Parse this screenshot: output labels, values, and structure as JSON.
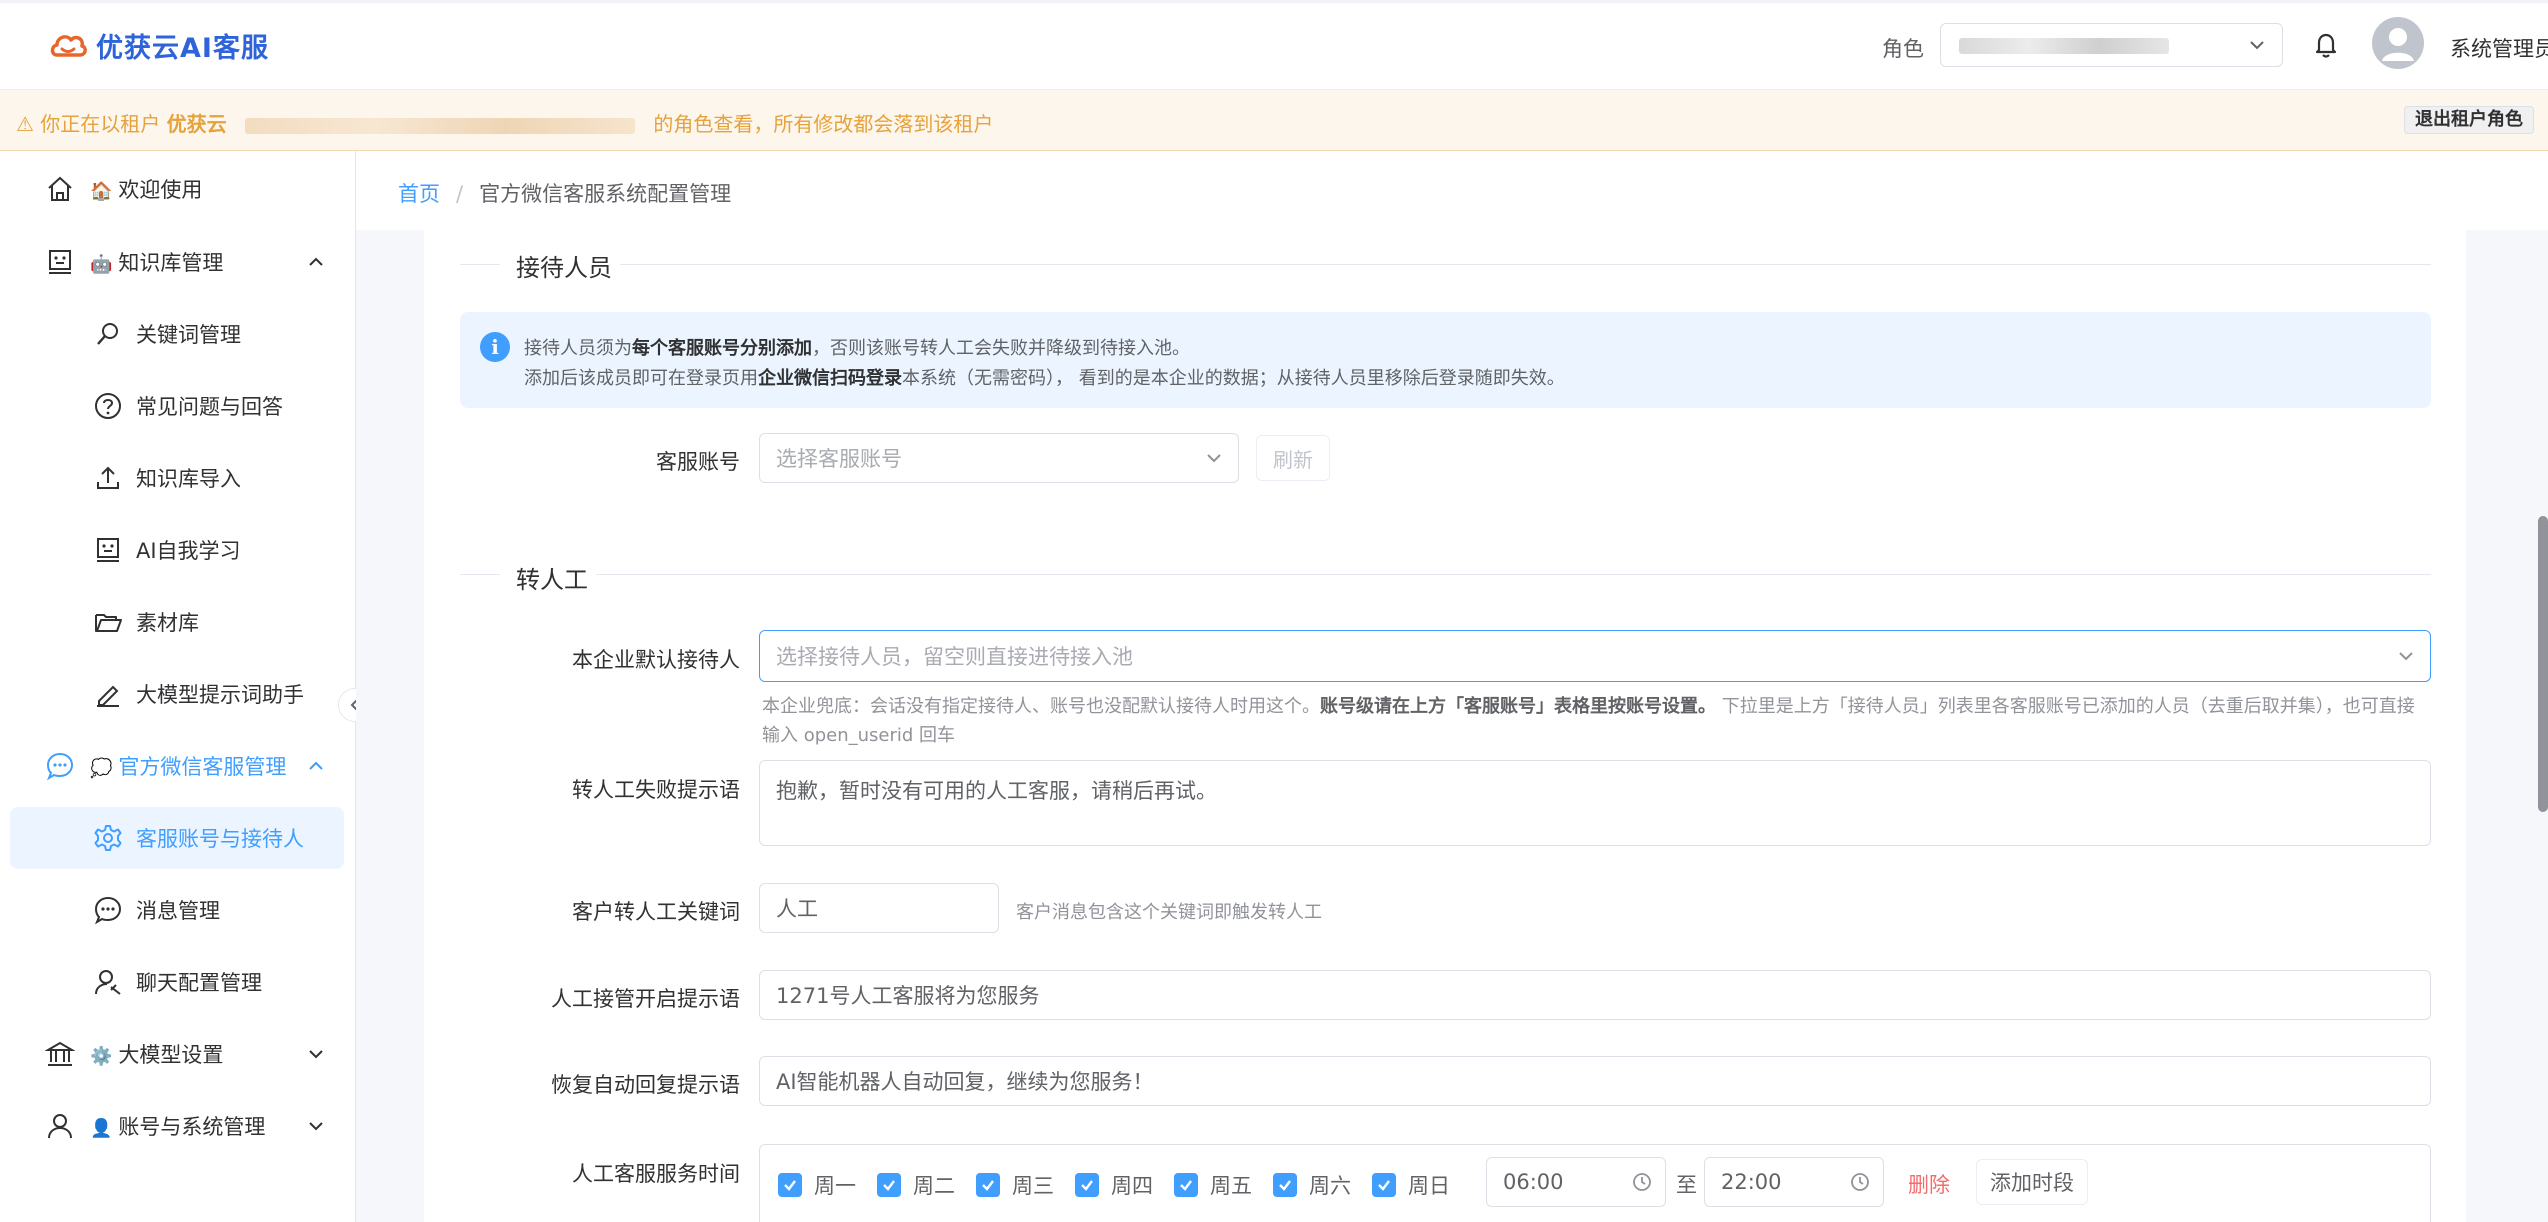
{
  "app": {
    "brand": "优获云AI客服",
    "role_label": "角色",
    "user_name": "系统管理员"
  },
  "warning": {
    "prefix": "⚠ 你正在以租户",
    "tenant": "优获云",
    "suffix": "的角色查看，所有修改都会落到该租户",
    "exit_button": "退出租户角色"
  },
  "sidebar": {
    "items": [
      {
        "label": "欢迎使用",
        "emoji": "🏠"
      },
      {
        "label": "知识库管理",
        "emoji": "🤖"
      },
      {
        "label": "关键词管理"
      },
      {
        "label": "常见问题与回答"
      },
      {
        "label": "知识库导入"
      },
      {
        "label": "AI自我学习"
      },
      {
        "label": "素材库"
      },
      {
        "label": "大模型提示词助手"
      },
      {
        "label": "官方微信客服管理",
        "emoji": "💭"
      },
      {
        "label": "客服账号与接待人"
      },
      {
        "label": "消息管理"
      },
      {
        "label": "聊天配置管理"
      },
      {
        "label": "大模型设置",
        "emoji": "⚙️"
      },
      {
        "label": "账号与系统管理",
        "emoji": "👤"
      }
    ]
  },
  "breadcrumb": {
    "home": "首页",
    "separator": "/",
    "current": "官方微信客服系统配置管理"
  },
  "reception": {
    "section_title": "接待人员",
    "info_line1_a": "接待人员须为",
    "info_line1_b": "每个客服账号分别添加",
    "info_line1_c": "，否则该账号转人工会失败并降级到待接入池。",
    "info_line2_a": "添加后该成员即可在登录页用",
    "info_line2_b": "企业微信扫码登录",
    "info_line2_c": "本系统（无需密码），  看到的是本企业的数据；从接待人员里移除后登录随即失效。",
    "account_label": "客服账号",
    "account_placeholder": "选择客服账号",
    "refresh_button": "刷新"
  },
  "transfer": {
    "section_title": "转人工",
    "default_receiver_label": "本企业默认接待人",
    "default_receiver_placeholder": "选择接待人员，留空则直接进待接入池",
    "default_hint_a": "本企业兜底：会话没有指定接待人、账号也没配默认接待人时用这个。",
    "default_hint_b": "账号级请在上方「客服账号」表格里按账号设置。",
    "default_hint_c": " 下拉里是上方「接待人员」列表里各客服账号已添加的人员（去重后取并集），也可直接",
    "default_hint_d": "输入 open_userid 回车",
    "fail_tip_label": "转人工失败提示语",
    "fail_tip_value": "抱歉，暂时没有可用的人工客服，请稍后再试。",
    "keyword_label": "客户转人工关键词",
    "keyword_value": "人工",
    "keyword_hint": "客户消息包含这个关键词即触发转人工",
    "takeover_label": "人工接管开启提示语",
    "takeover_value": "1271号人工客服将为您服务",
    "resume_label": "恢复自动回复提示语",
    "resume_value": "AI智能机器人自动回复，继续为您服务！",
    "service_time_label": "人工客服服务时间",
    "weekdays": [
      "周一",
      "周二",
      "周三",
      "周四",
      "周五",
      "周六",
      "周日"
    ],
    "start_time": "06:00",
    "to_label": "至",
    "end_time": "22:00",
    "delete_button": "删除",
    "add_slot_button": "添加时段"
  },
  "colors": {
    "brand_orange": "#e8662c",
    "brand_blue": "#2f63d9",
    "primary": "#409eff",
    "warning": "#e6a23c",
    "danger": "#f56c6c"
  }
}
